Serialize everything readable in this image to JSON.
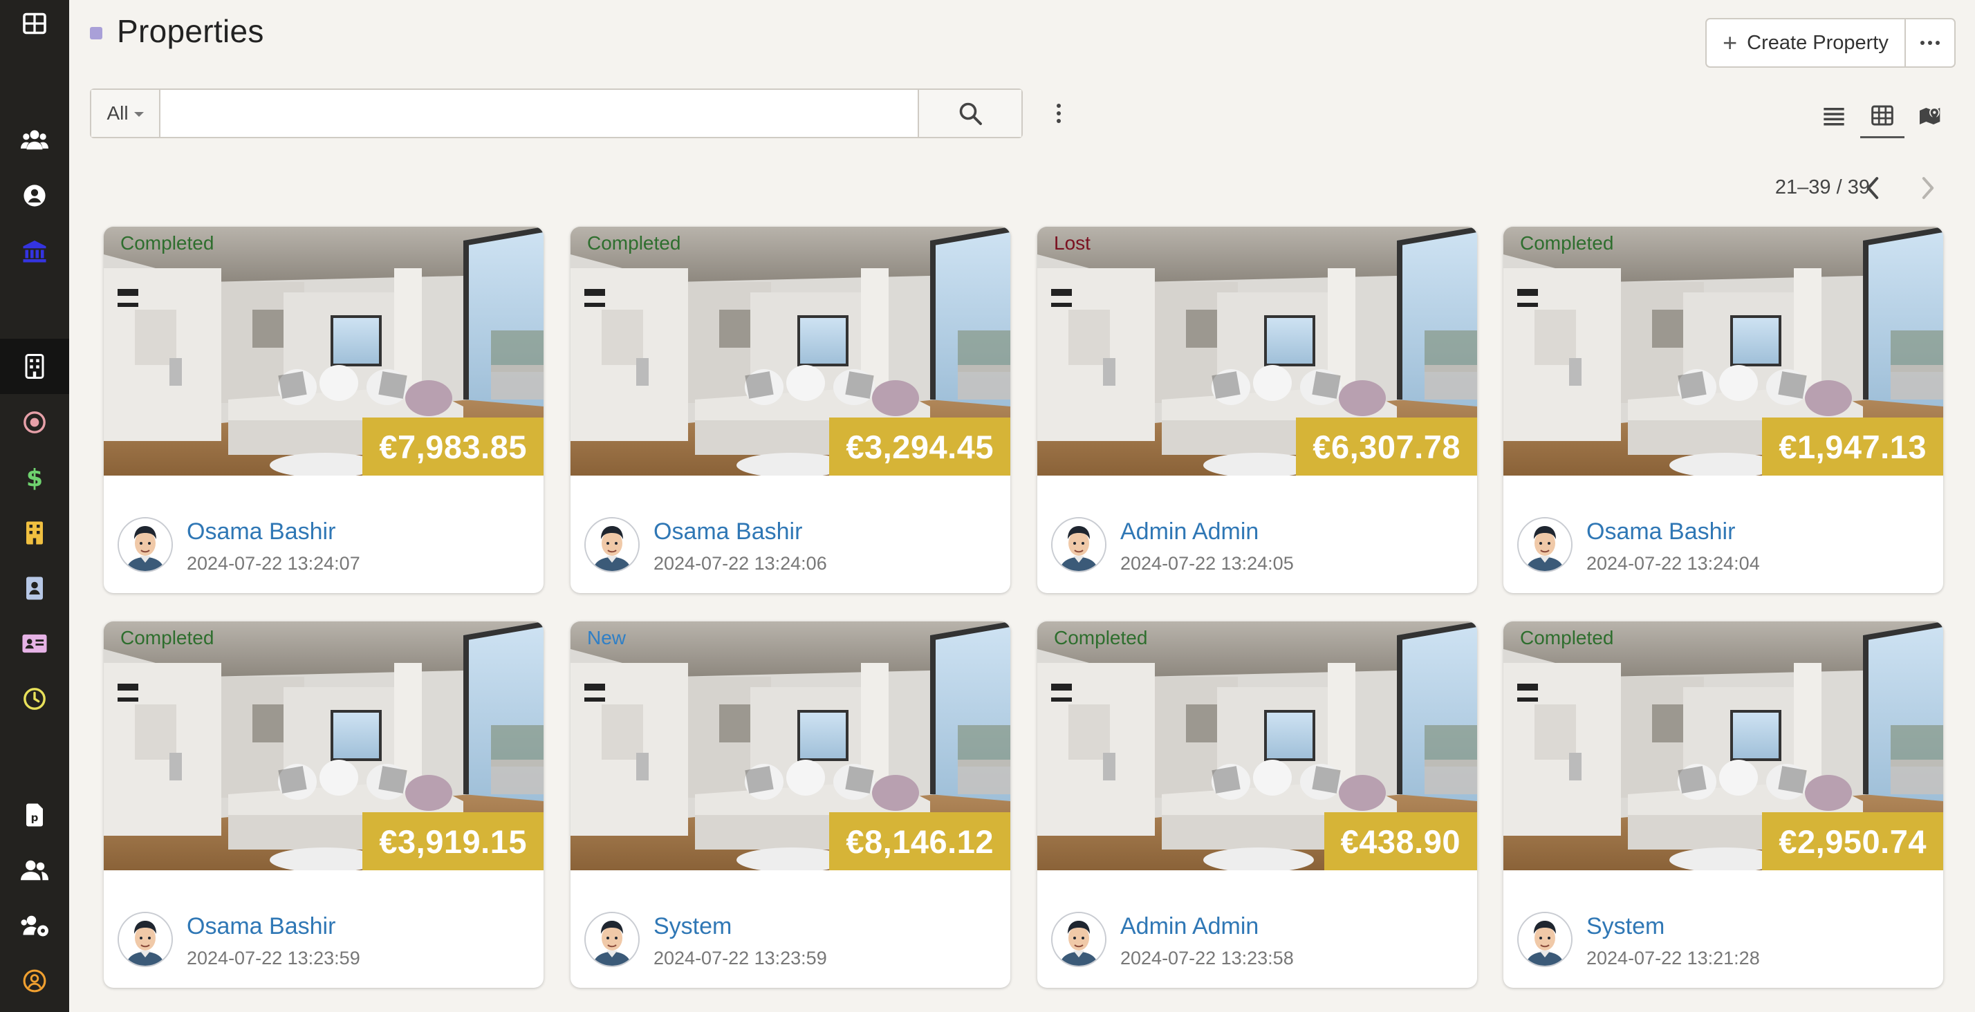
{
  "header": {
    "title": "Properties",
    "create_label": "Create Property"
  },
  "search": {
    "filter": "All",
    "query": "",
    "placeholder": ""
  },
  "pager": {
    "range": "21–39 / 39"
  },
  "sidebar": {
    "icons": [
      "apps-icon",
      "users-group-icon",
      "user-circle-icon",
      "bank-icon",
      "property-icon",
      "target-icon",
      "dollar-icon",
      "building-icon",
      "contact-book-icon",
      "id-card-icon",
      "clock-icon",
      "pdf-document-icon",
      "people-icon",
      "users-settings-icon",
      "user-account-icon"
    ],
    "active": "property-icon"
  },
  "views": [
    "list-view-icon",
    "grid-view-icon",
    "map-view-icon"
  ],
  "cards": [
    {
      "status": "Completed",
      "price": "€7,983.85",
      "owner": "Osama Bashir",
      "date": "2024-07-22 13:24:07"
    },
    {
      "status": "Completed",
      "price": "€3,294.45",
      "owner": "Osama Bashir",
      "date": "2024-07-22 13:24:06"
    },
    {
      "status": "Lost",
      "price": "€6,307.78",
      "owner": "Admin Admin",
      "date": "2024-07-22 13:24:05"
    },
    {
      "status": "Completed",
      "price": "€1,947.13",
      "owner": "Osama Bashir",
      "date": "2024-07-22 13:24:04"
    },
    {
      "status": "Completed",
      "price": "€3,919.15",
      "owner": "Osama Bashir",
      "date": "2024-07-22 13:23:59"
    },
    {
      "status": "New",
      "price": "€8,146.12",
      "owner": "System",
      "date": "2024-07-22 13:23:59"
    },
    {
      "status": "Completed",
      "price": "€438.90",
      "owner": "Admin Admin",
      "date": "2024-07-22 13:23:58"
    },
    {
      "status": "Completed",
      "price": "€2,950.74",
      "owner": "System",
      "date": "2024-07-22 13:21:28"
    }
  ],
  "colors": {
    "sidebar_bg": "#23221f",
    "price_badge": "#d6b437",
    "link": "#2f77b5",
    "status_completed": "#2e6e2e",
    "status_lost": "#7a1020",
    "status_new": "#2f7fc6"
  }
}
